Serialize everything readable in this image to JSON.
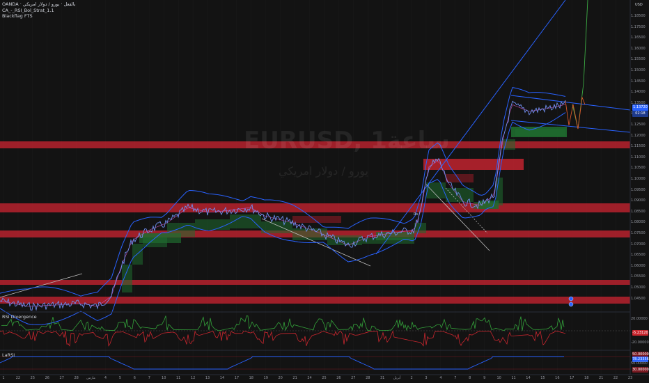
{
  "legend": {
    "line1": "OANDA · بالفعل · يورو / دولار امريكي",
    "line2": "CA_-_RSI_Bol_Strat_1.1",
    "line3": "Blackflag FTS"
  },
  "watermark": {
    "symbol": "EURUSD, 1ساعة",
    "name": "يورو / دولار امريكي"
  },
  "currency": "USD",
  "price_axis": [
    "1.18500",
    "1.17500",
    "1.16500",
    "1.16000",
    "1.15500",
    "1.15000",
    "1.14500",
    "1.14000",
    "1.13500",
    "1.13000",
    "1.12500",
    "1.12000",
    "1.11500",
    "1.11000",
    "1.10500",
    "1.10000",
    "1.09500",
    "1.09000",
    "1.08500",
    "1.08000",
    "1.07500",
    "1.07000",
    "1.06500",
    "1.06000",
    "1.05500",
    "1.05000",
    "1.04500"
  ],
  "current_price": {
    "value": "1.13720",
    "sub": "02:18"
  },
  "rsi_pane": {
    "title": "RSI Divergence",
    "axis": [
      "20.00000",
      "-20.00000"
    ],
    "value": "-5.23120"
  },
  "lar_pane": {
    "title": "LaRSI",
    "axis": [
      "50.00000",
      "0.00000"
    ],
    "values": [
      "50.00000",
      "78.23356",
      "30.00000"
    ]
  },
  "date_axis": [
    "1",
    "22",
    "25",
    "26",
    "27",
    "28",
    "مارس",
    "4",
    "5",
    "6",
    "7",
    "10",
    "11",
    "12",
    "13",
    "14",
    "17",
    "18",
    "19",
    "20",
    "21",
    "24",
    "25",
    "26",
    "27",
    "28",
    "31",
    "أبريل",
    "2",
    "3",
    "4",
    "7",
    "8",
    "9",
    "10",
    "11",
    "14",
    "15",
    "16",
    "17",
    "18",
    "21",
    "22",
    "23"
  ],
  "colors": {
    "bg": "#131313",
    "red_zone": "#b7222e",
    "green_zone": "#1f6b2f",
    "blue": "#2962ff",
    "price": "#6f8ff0"
  }
}
